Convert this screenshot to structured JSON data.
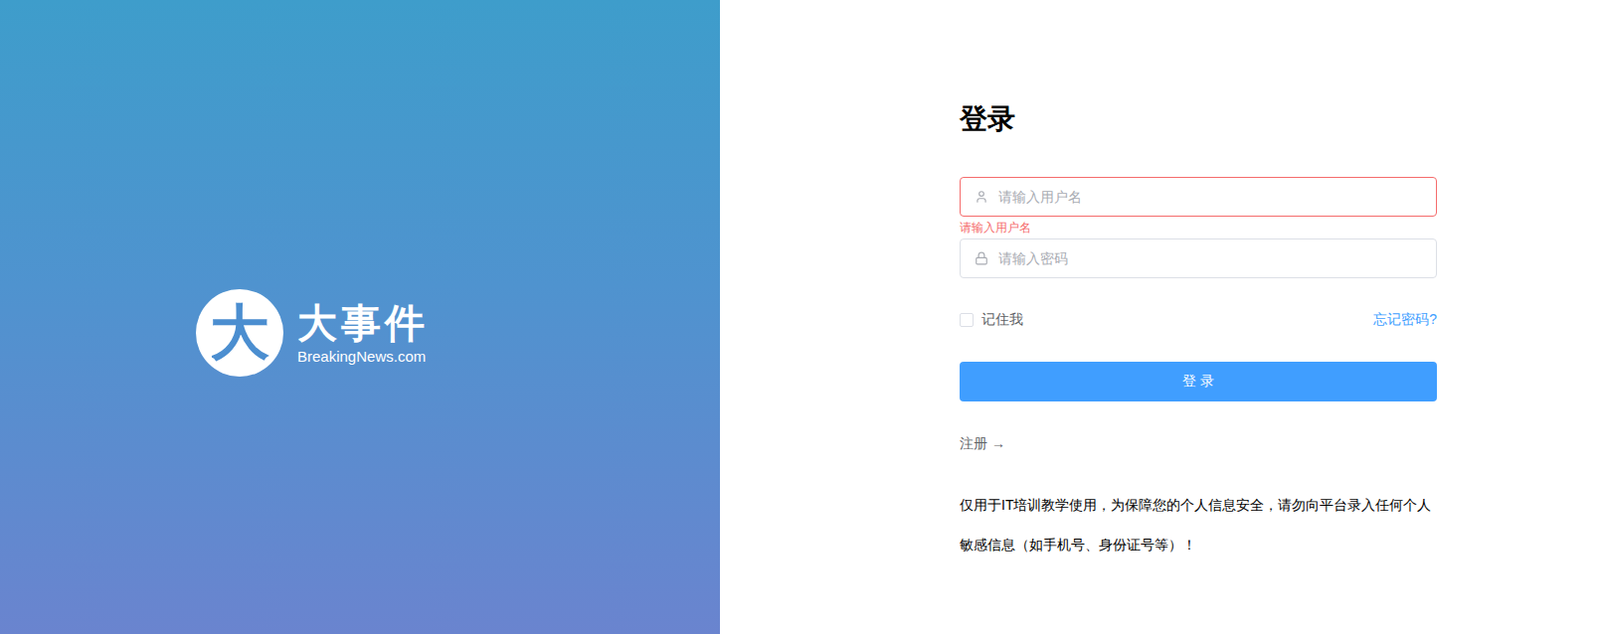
{
  "brand": {
    "mark": "大",
    "name": "大事件",
    "subtitle": "BreakingNews.com"
  },
  "form": {
    "title": "登录",
    "fields": [
      {
        "kind": "username",
        "placeholder": "请输入用户名",
        "invalid": true,
        "error": "请输入用户名"
      },
      {
        "kind": "password",
        "placeholder": "请输入密码",
        "invalid": false,
        "error": ""
      }
    ],
    "remember": {
      "label": "记住我",
      "checked": false
    },
    "forgot": "忘记密码?",
    "submit": "登 录",
    "register": "注册 →",
    "notice": "仅用于IT培训教学使用，为保障您的个人信息安全，请勿向平台录入任何个人敏感信息（如手机号、身份证号等）！"
  }
}
